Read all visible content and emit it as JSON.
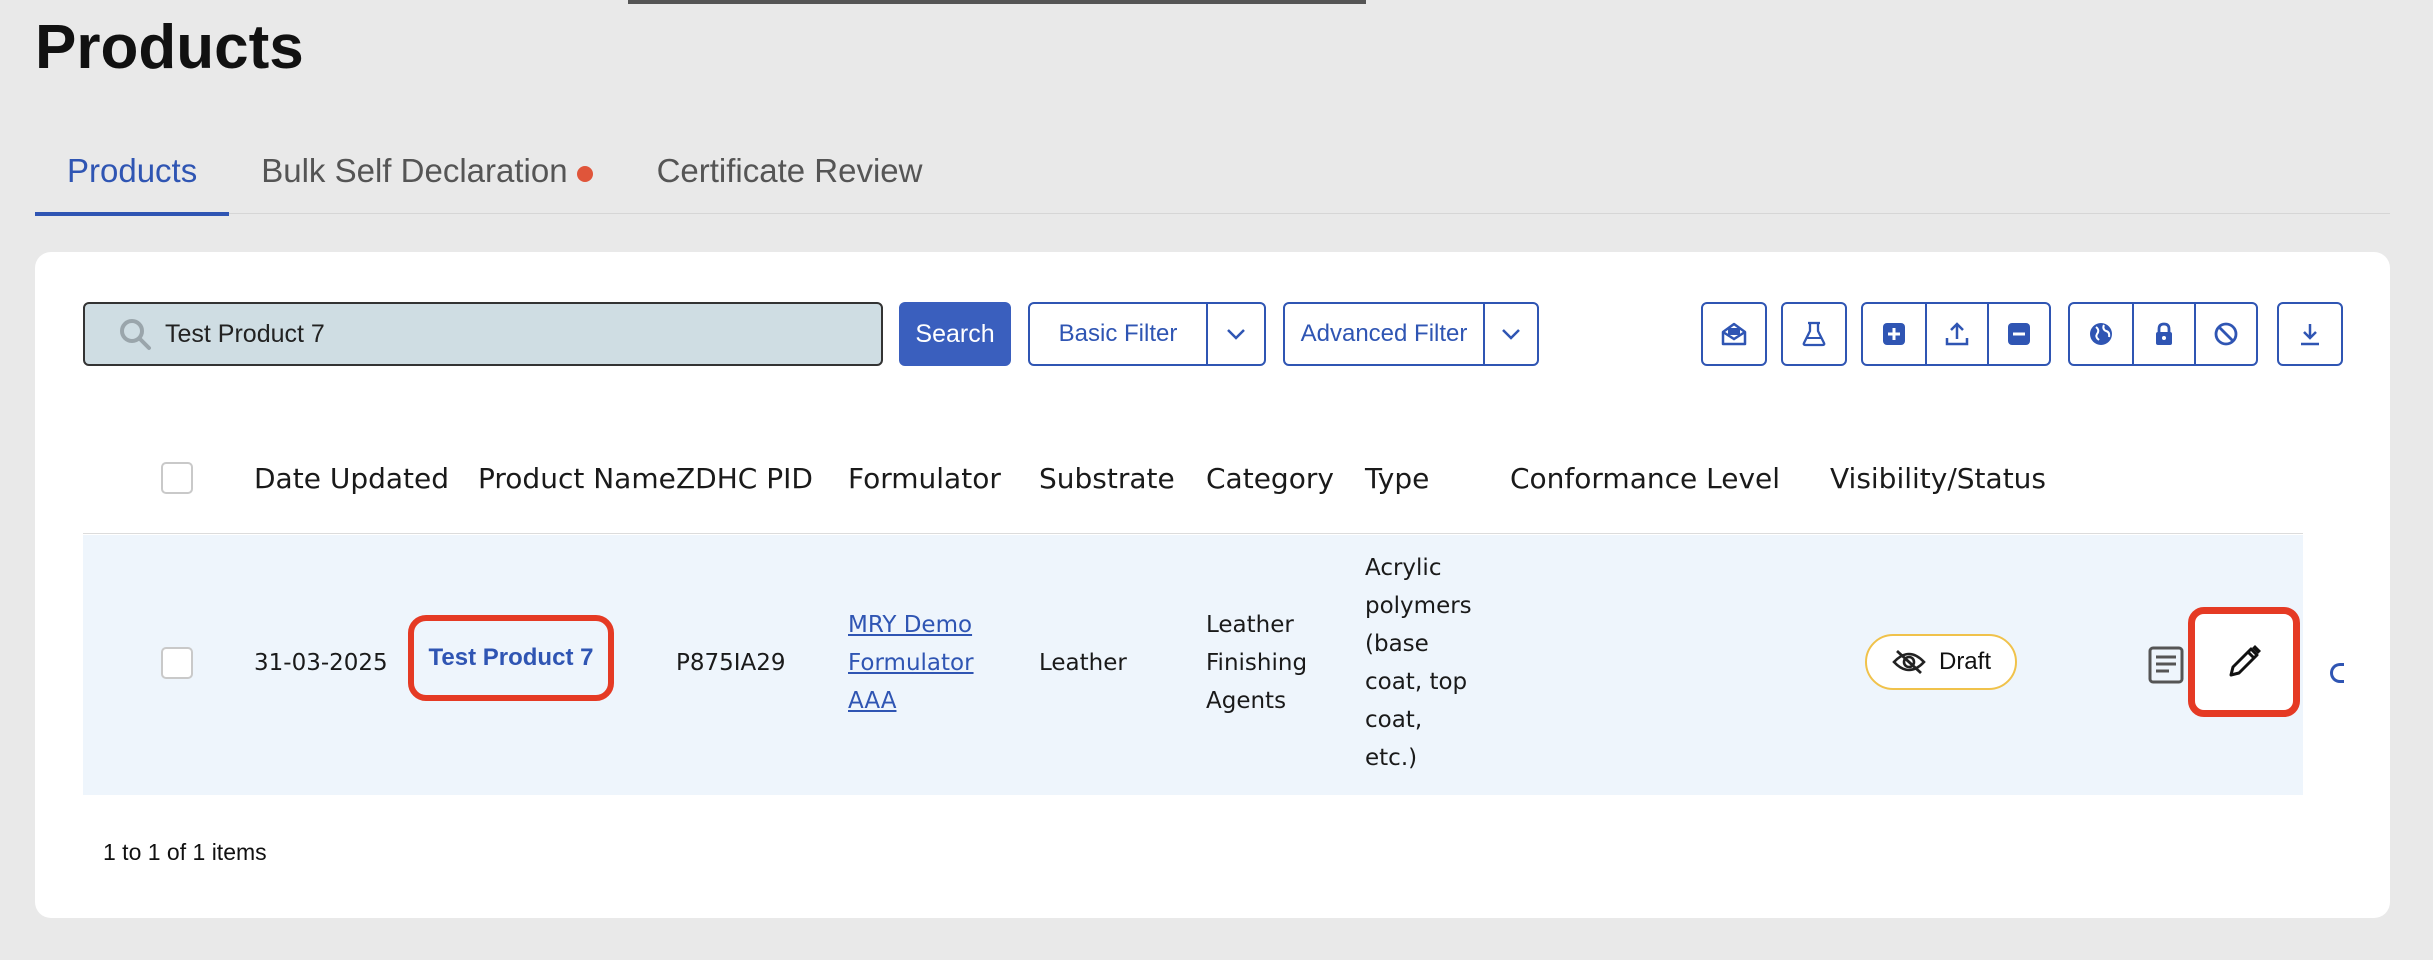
{
  "page": {
    "title": "Products"
  },
  "tabs": [
    {
      "label": "Products",
      "active": true
    },
    {
      "label": "Bulk Self Declaration",
      "active": false,
      "has_dot": true
    },
    {
      "label": "Certificate Review",
      "active": false
    }
  ],
  "toolbar": {
    "search_value": "Test Product 7",
    "search_button": "Search",
    "basic_filter": "Basic Filter",
    "advanced_filter": "Advanced Filter",
    "icons": [
      "mail-open-icon",
      "flask-icon",
      "plus-square-icon",
      "upload-icon",
      "minus-square-icon",
      "globe-icon",
      "lock-icon",
      "block-icon",
      "download-icon"
    ]
  },
  "table": {
    "columns": [
      "Date Updated",
      "Product Name",
      "ZDHC PID",
      "Formulator",
      "Substrate",
      "Category",
      "Type",
      "Conformance Level",
      "Visibility/Status"
    ],
    "rows": [
      {
        "date_updated": "31-03-2025",
        "product_name": "Test Product 7",
        "zdhc_pid": "P875IA29",
        "formulator_lines": [
          "MRY Demo",
          "Formulator",
          "AAA"
        ],
        "substrate": "Leather",
        "category_lines": [
          "Leather",
          "Finishing",
          "Agents"
        ],
        "type_lines": [
          "Acrylic",
          "polymers",
          "(base",
          "coat, top",
          "coat,",
          "etc.)"
        ],
        "conformance_level": "",
        "status": "Draft"
      }
    ]
  },
  "pager": {
    "text": "1 to 1 of 1 items"
  },
  "colors": {
    "accent": "#2f55b3",
    "highlight": "#e53a24",
    "draft_border": "#f0c24b",
    "row_bg": "#eef5fc"
  }
}
